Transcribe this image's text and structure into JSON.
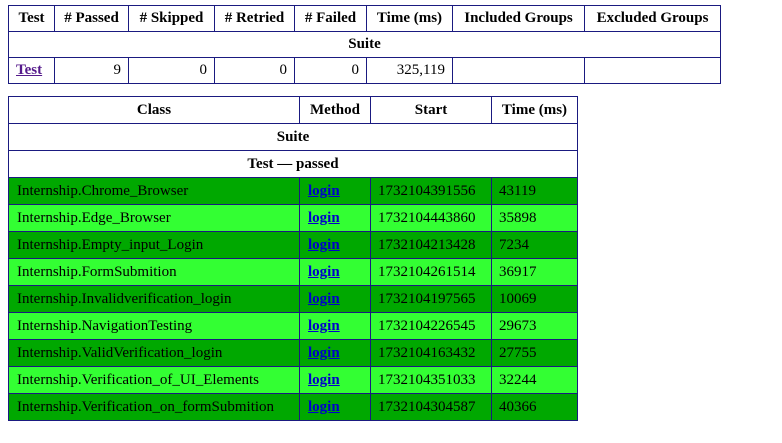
{
  "summary": {
    "headers": [
      "Test",
      "# Passed",
      "# Skipped",
      "# Retried",
      "# Failed",
      "Time (ms)",
      "Included Groups",
      "Excluded Groups"
    ],
    "suite_label": "Suite",
    "row": {
      "test": "Test",
      "passed": "9",
      "skipped": "0",
      "retried": "0",
      "failed": "0",
      "time": "325,119",
      "included": "",
      "excluded": ""
    }
  },
  "methods": {
    "headers": [
      "Class",
      "Method",
      "Start",
      "Time (ms)"
    ],
    "suite_label": "Suite",
    "test_label": "Test — passed",
    "rows": [
      {
        "class": "Internship.Chrome_Browser",
        "method": "login",
        "start": "1732104391556",
        "time": "43119"
      },
      {
        "class": "Internship.Edge_Browser",
        "method": "login",
        "start": "1732104443860",
        "time": "35898"
      },
      {
        "class": "Internship.Empty_input_Login",
        "method": "login",
        "start": "1732104213428",
        "time": "7234"
      },
      {
        "class": "Internship.FormSubmition",
        "method": "login",
        "start": "1732104261514",
        "time": "36917"
      },
      {
        "class": "Internship.Invalidverification_login",
        "method": "login",
        "start": "1732104197565",
        "time": "10069"
      },
      {
        "class": "Internship.NavigationTesting",
        "method": "login",
        "start": "1732104226545",
        "time": "29673"
      },
      {
        "class": "Internship.ValidVerification_login",
        "method": "login",
        "start": "1732104163432",
        "time": "27755"
      },
      {
        "class": "Internship.Verification_of_UI_Elements",
        "method": "login",
        "start": "1732104351033",
        "time": "32244"
      },
      {
        "class": "Internship.Verification_on_formSubmition",
        "method": "login",
        "start": "1732104304587",
        "time": "40366"
      }
    ]
  },
  "colors": {
    "row_dark": "#00a800",
    "row_light": "#33ff33",
    "border": "#1a1a80",
    "link": "#0000cc",
    "link_visited": "#551a8b"
  }
}
